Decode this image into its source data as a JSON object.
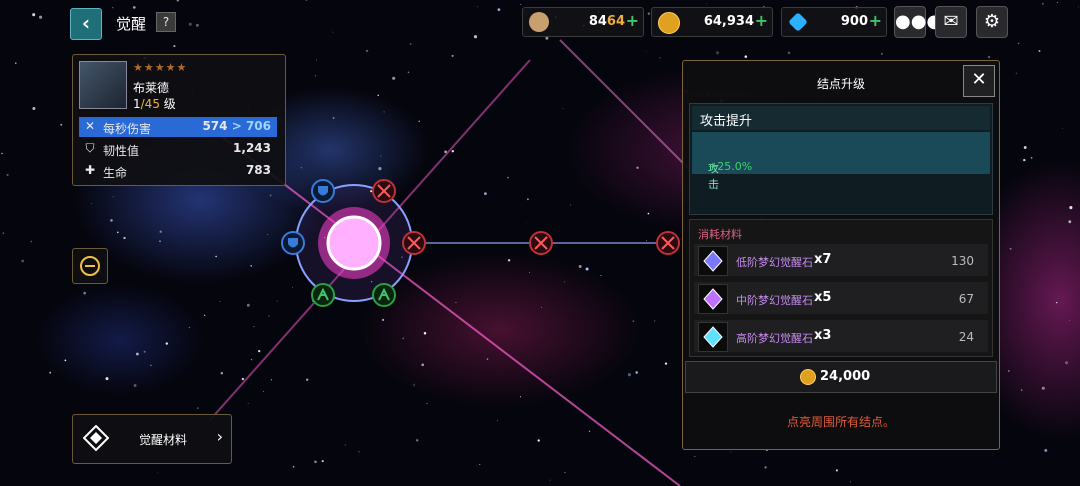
{
  "header": {
    "back_icon": "chevron-left-icon",
    "title": "觉醒",
    "help_label": "?"
  },
  "resources": {
    "stamina": {
      "current": "84",
      "max": "64",
      "icon": "coffee-cup-icon"
    },
    "gold": {
      "value": "64,934",
      "icon": "gold-coin-icon"
    },
    "gems": {
      "value": "900",
      "icon": "diamond-icon"
    },
    "plus_label": "+"
  },
  "top_buttons": [
    "chat-icon",
    "mail-icon",
    "gear-icon"
  ],
  "hero": {
    "name": "布莱德",
    "level": "1",
    "level_max": "/45",
    "level_suffix": " 级",
    "stars": "★★★★★",
    "stats": [
      {
        "label": "每秒伤害",
        "value": "574",
        "arrow": " > ",
        "new_value": "706",
        "icon": "sword-icon"
      },
      {
        "label": "韧性值",
        "value": "1,243",
        "icon": "shield-icon"
      },
      {
        "label": "生命",
        "value": "783",
        "icon": "health-cross-icon"
      }
    ]
  },
  "materials_button": {
    "label": "觉醒材料",
    "chevron": "›"
  },
  "panel": {
    "title": "结点升级",
    "close_label": "✕",
    "effect_title": "攻击提升",
    "effect_desc_label": "攻击",
    "effect_desc_value": "+25.0%",
    "materials_title": "消耗材料",
    "materials": [
      {
        "name": "低阶梦幻觉醒石",
        "qty": "x7",
        "owned": "130",
        "color": "#7a78ff"
      },
      {
        "name": "中阶梦幻觉醒石",
        "qty": "x5",
        "owned": "67",
        "color": "#c070ff"
      },
      {
        "name": "高阶梦幻觉醒石",
        "qty": "x3",
        "owned": "24",
        "color": "#60e0ff"
      }
    ],
    "cost": "24,000",
    "warning": "点亮周围所有结点。"
  },
  "colors": {
    "accent_blue": "#2a6ad6",
    "gold": "#f0b040",
    "green": "#3ec46a",
    "warning": "#e05a3a"
  }
}
